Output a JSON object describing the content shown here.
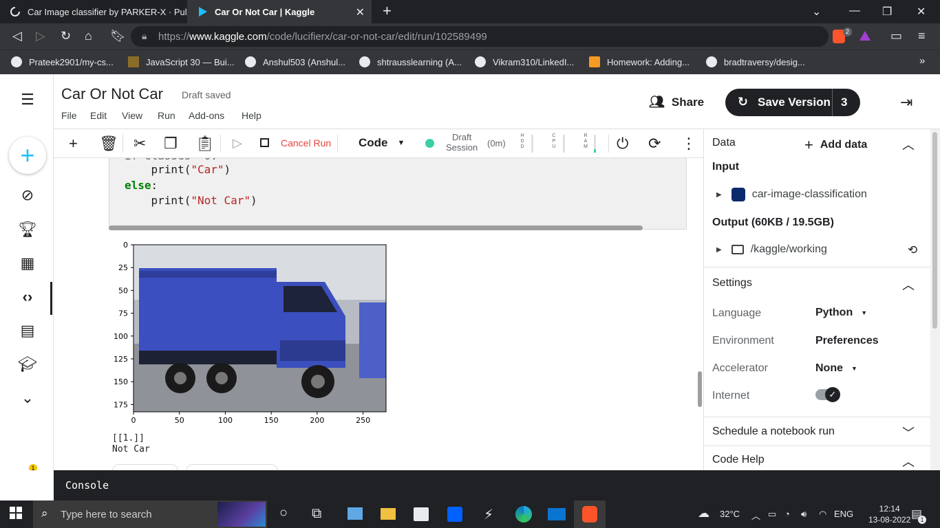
{
  "browser": {
    "tabs": [
      {
        "title": "Car Image classifier by PARKER-X · Pul"
      },
      {
        "title": "Car Or Not Car | Kaggle"
      }
    ],
    "url_prefix": "https://",
    "url_domain": "www.kaggle.com",
    "url_path": "/code/lucifierx/car-or-not-car/edit/run/102589499",
    "brave_badge": "2",
    "bookmarks": [
      "Prateek2901/my-cs...",
      "JavaScript 30 — Bui...",
      "Anshul503 (Anshul...",
      "shtrausslearning (A...",
      "Vikram310/LinkedI...",
      "Homework: Adding...",
      "bradtraversy/desig..."
    ],
    "bookmark_more": "»"
  },
  "header": {
    "title": "Car Or Not Car",
    "draft_status": "Draft saved",
    "menu": [
      "File",
      "Edit",
      "View",
      "Run",
      "Add-ons",
      "Help"
    ],
    "share_label": "Share",
    "save_label": "Save Version",
    "save_count": "3"
  },
  "toolbar": {
    "cancel_run": "Cancel Run",
    "cell_type": "Code",
    "session_line1": "Draft",
    "session_line2": "Session",
    "session_time": "(0m)",
    "hdd": "H D D",
    "cpu": "C P U",
    "ram": "R A M"
  },
  "notebook": {
    "code_lines": [
      {
        "indent": "    ",
        "fn": "print(",
        "str": "\"Car\"",
        "close": ")"
      },
      {
        "kw": "else",
        "rest": ":"
      },
      {
        "indent": "    ",
        "fn": "print(",
        "str": "\"Not Car\"",
        "close": ")"
      }
    ],
    "code_line1": "    print(\"Car\")",
    "code_else": "else",
    "code_line3": "    print(\"Not Car\")",
    "output_text": "[[1.]]\nNot Car"
  },
  "chart_data": {
    "type": "image",
    "xticks": [
      "0",
      "50",
      "100",
      "150",
      "200",
      "250"
    ],
    "yticks": [
      "0",
      "25",
      "50",
      "75",
      "100",
      "125",
      "150",
      "175"
    ],
    "xlim": [
      0,
      275
    ],
    "ylim": [
      0,
      183
    ]
  },
  "right_panel": {
    "data_label": "Data",
    "add_data": "Add data",
    "input_label": "Input",
    "input_item": "car-image-classification",
    "output_label": "Output (60KB / 19.5GB)",
    "output_item": "/kaggle/working",
    "settings_label": "Settings",
    "language_label": "Language",
    "language_value": "Python",
    "environment_label": "Environment",
    "environment_value": "Preferences",
    "accelerator_label": "Accelerator",
    "accelerator_value": "None",
    "internet_label": "Internet",
    "internet_on": true,
    "schedule_label": "Schedule a notebook run",
    "codehelp_label": "Code Help"
  },
  "console": {
    "label": "Console"
  },
  "rail": {
    "notification_count": "1"
  },
  "taskbar": {
    "search_placeholder": "Type here to search",
    "temperature": "32°C",
    "language": "ENG",
    "time": "12:14",
    "date": "13-08-2022",
    "notification_count": "1"
  },
  "colors": {
    "kaggle_blue": "#20beff",
    "session_green": "#3ccfa5",
    "cancel_red": "#e8453c",
    "truck_blue": "#3c4fbf"
  }
}
